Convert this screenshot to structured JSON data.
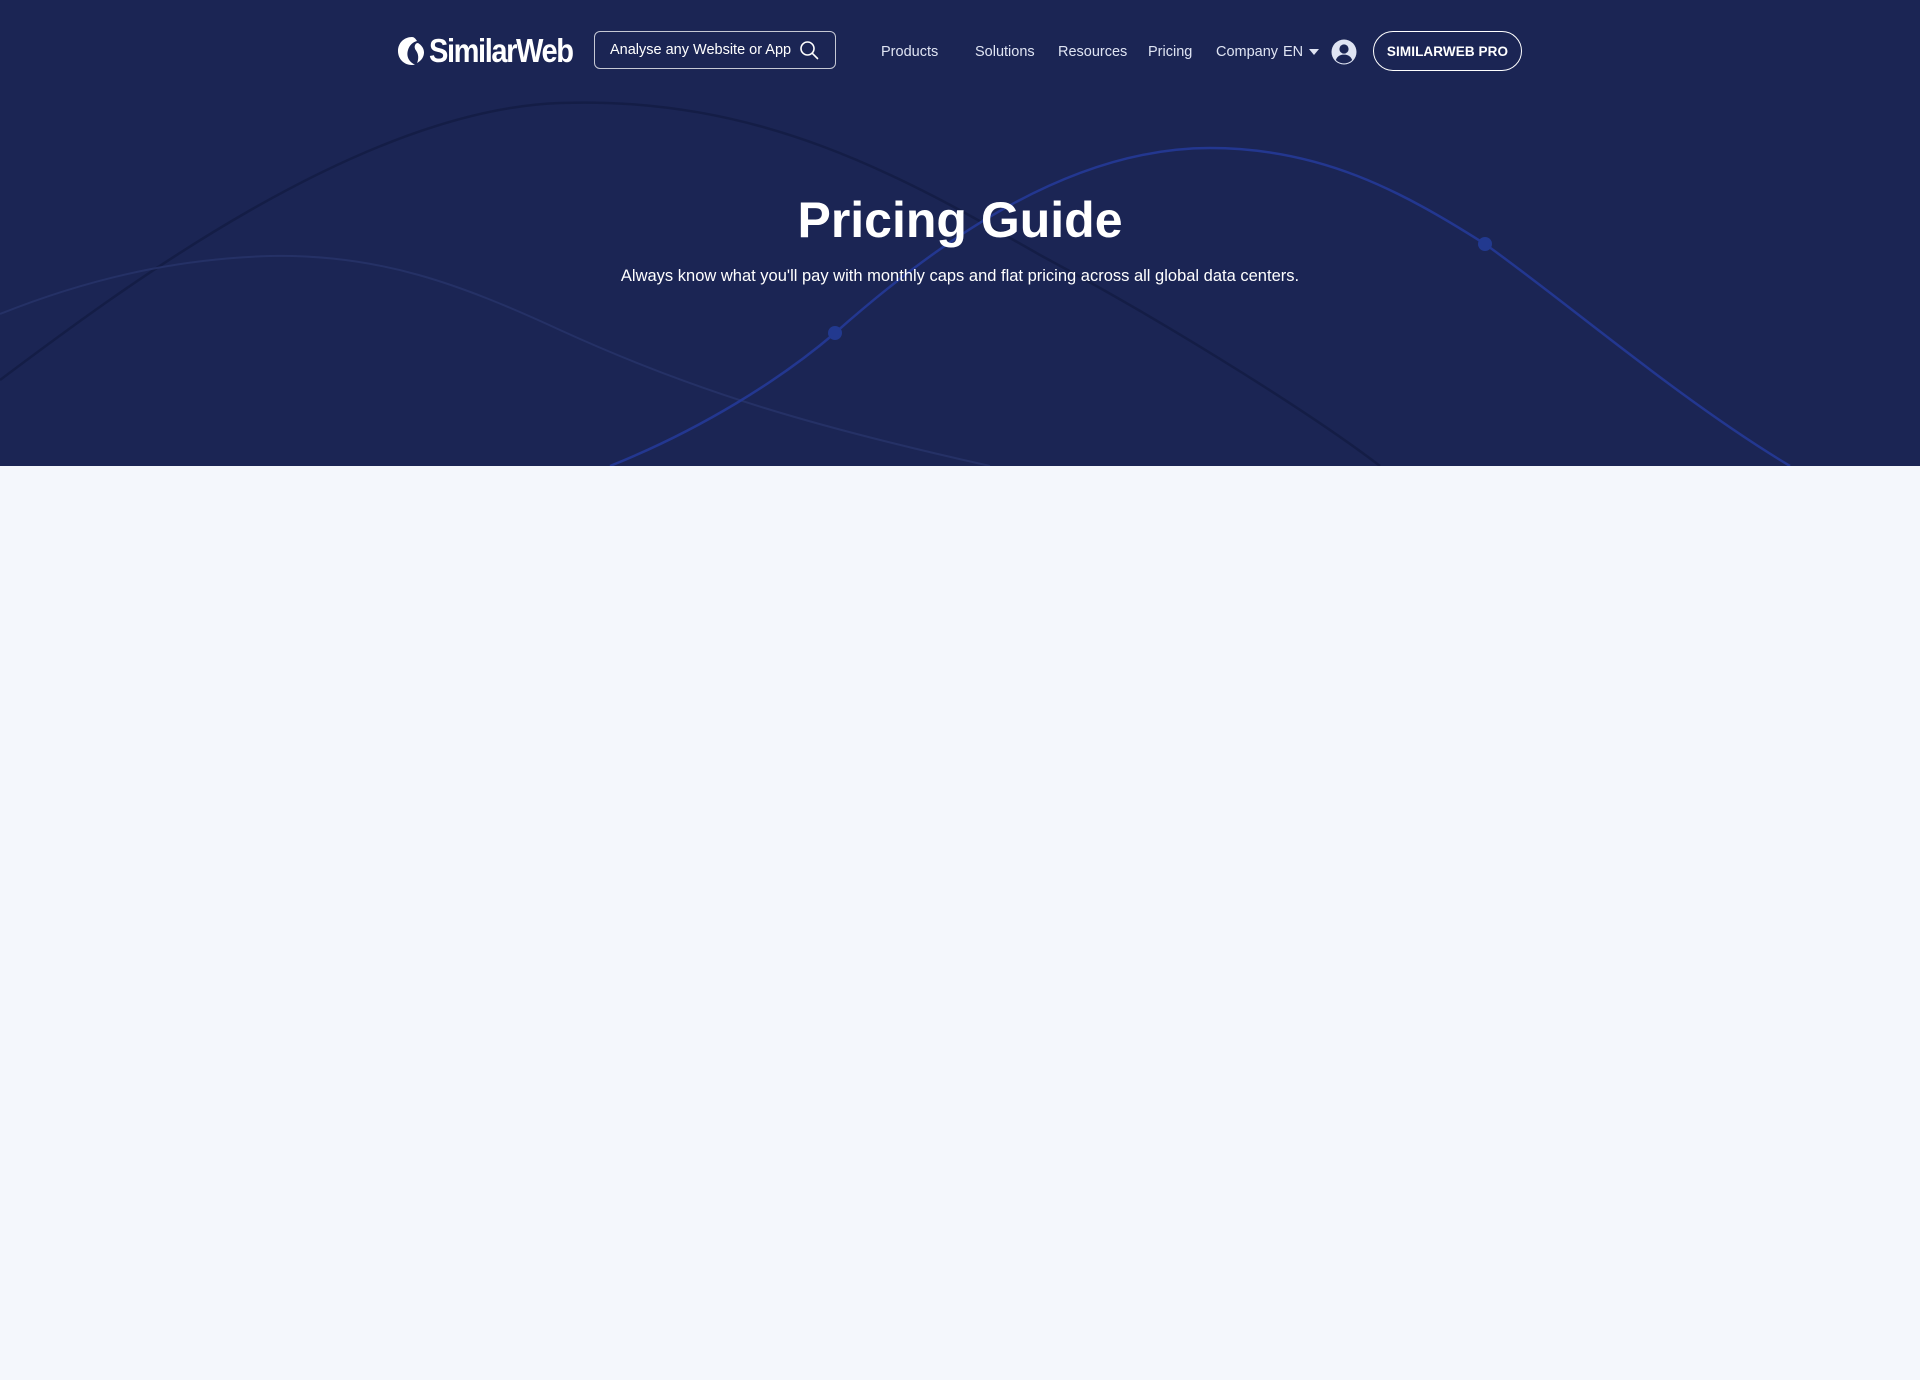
{
  "header": {
    "logo_text": "SimilarWeb",
    "search": {
      "placeholder": "Analyse any Website or App",
      "icon": "search-icon"
    },
    "nav_items": [
      {
        "label": "Products"
      },
      {
        "label": "Solutions"
      },
      {
        "label": "Resources"
      },
      {
        "label": "Pricing"
      },
      {
        "label": "Company"
      }
    ],
    "language": {
      "selected": "EN",
      "icon": "caret-down-icon"
    },
    "user_icon": "user-circle-icon",
    "pro_button_label": "SIMILARWEB PRO"
  },
  "hero": {
    "title": "Pricing Guide",
    "subtitle": "Always know what you'll pay with monthly caps and flat pricing across all global data centers."
  },
  "colors": {
    "hero_background": "#1b2554",
    "page_background": "#f4f7fc",
    "text_on_dark": "#ffffff",
    "decor_line": "#24338a"
  }
}
